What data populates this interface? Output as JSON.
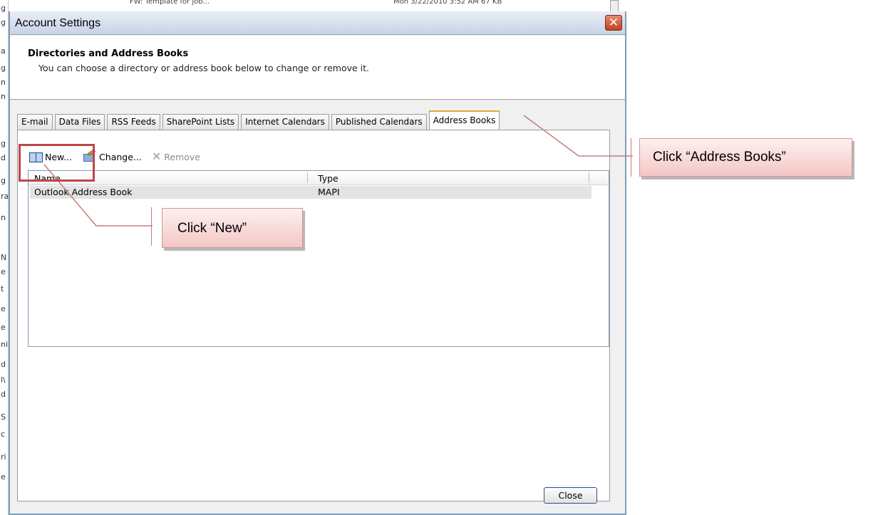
{
  "background": {
    "left_letters": [
      "g",
      "g",
      "a",
      "g",
      "n",
      "n",
      "g",
      "d",
      "g",
      "ra",
      "n",
      "N",
      "e",
      "t",
      "e",
      "e",
      "ni",
      "d",
      "l\\",
      "d",
      "S",
      "c",
      "ri",
      "e"
    ],
    "topline_left": "FW: Template for job...",
    "topline_right": "Mon 3/22/2010 3:52 AM 67 KB"
  },
  "dialog": {
    "title": "Account Settings",
    "close_glyph": "✕",
    "header_title": "Directories and Address Books",
    "header_subtitle": "You can choose a directory or address book below to change or remove it.",
    "tabs": [
      {
        "label": "E-mail",
        "active": false
      },
      {
        "label": "Data Files",
        "active": false
      },
      {
        "label": "RSS Feeds",
        "active": false
      },
      {
        "label": "SharePoint Lists",
        "active": false
      },
      {
        "label": "Internet Calendars",
        "active": false
      },
      {
        "label": "Published Calendars",
        "active": false
      },
      {
        "label": "Address Books",
        "active": true
      }
    ],
    "toolbar": {
      "new_label": "New...",
      "change_label": "Change...",
      "remove_label": "Remove"
    },
    "list": {
      "columns": [
        "Name",
        "Type"
      ],
      "rows": [
        {
          "name": "Outlook Address Book",
          "type": "MAPI"
        }
      ]
    },
    "close_button": "Close"
  },
  "annotations": {
    "callout_address_books": "Click “Address Books”",
    "callout_new": "Click “New”",
    "accent_color": "#c0454a"
  }
}
